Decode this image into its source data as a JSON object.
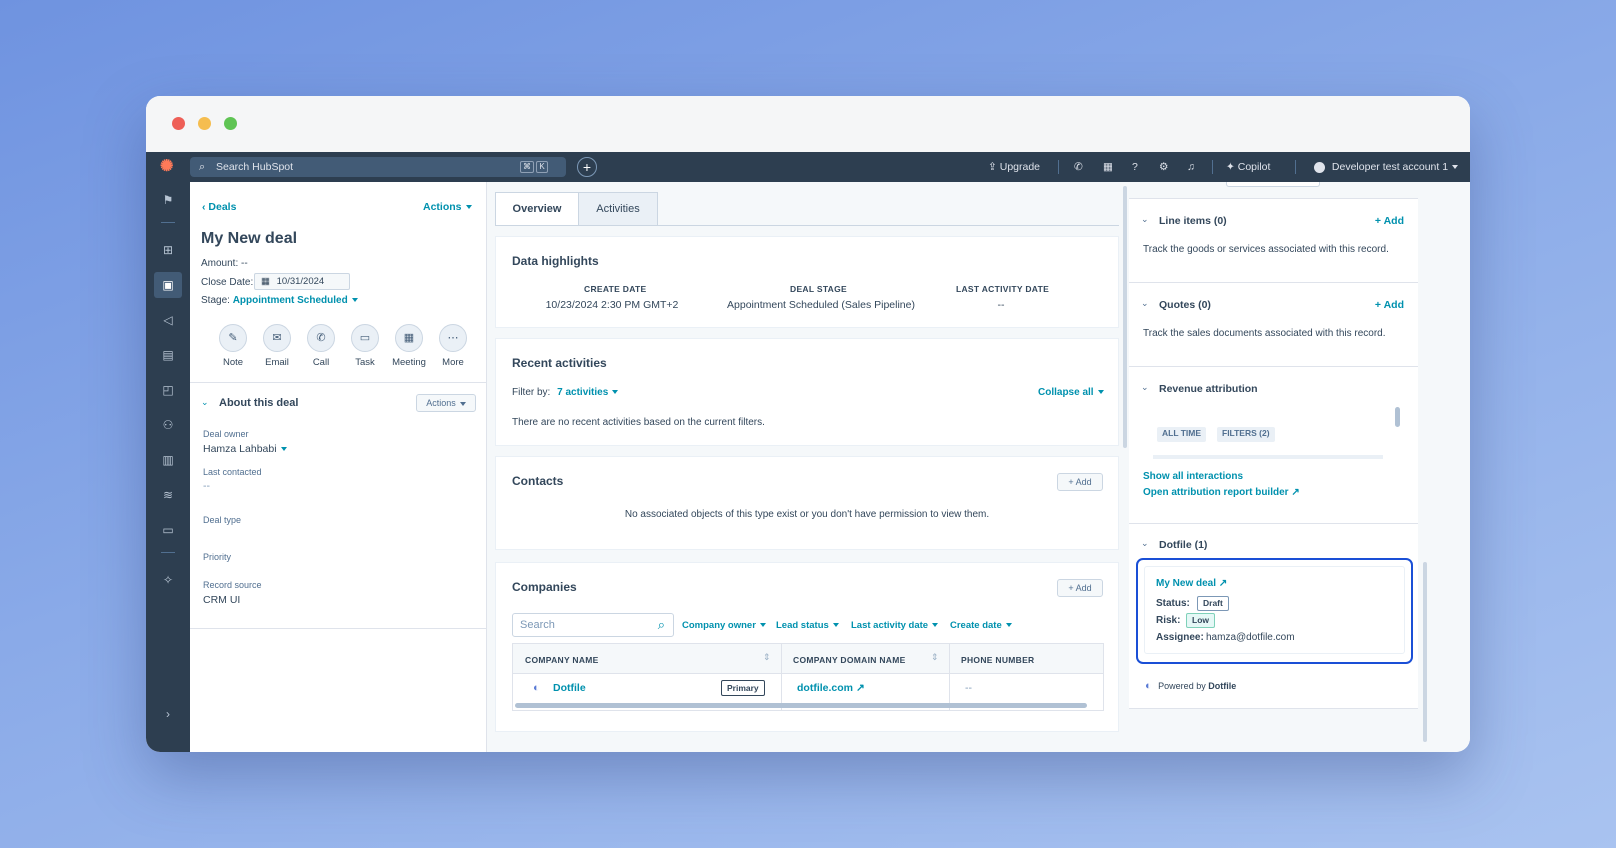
{
  "topnav": {
    "search_placeholder": "Search HubSpot",
    "kbd1": "⌘",
    "kbd2": "K",
    "upgrade": "Upgrade",
    "copilot": "Copilot",
    "account": "Developer test account 1"
  },
  "left": {
    "back": "Deals",
    "actions": "Actions",
    "title": "My New deal",
    "amount_label": "Amount:",
    "amount_value": "--",
    "close_label": "Close Date:",
    "close_value": "10/31/2024",
    "stage_label": "Stage:",
    "stage_value": "Appointment Scheduled",
    "quick_actions": [
      "Note",
      "Email",
      "Call",
      "Task",
      "Meeting",
      "More"
    ],
    "about_title": "About this deal",
    "about_actions": "Actions",
    "fields": [
      {
        "label": "Deal owner",
        "value": "Hamza Lahbabi"
      },
      {
        "label": "Last contacted",
        "value": "--"
      },
      {
        "label": "Deal type",
        "value": ""
      },
      {
        "label": "Priority",
        "value": ""
      },
      {
        "label": "Record source",
        "value": "CRM UI"
      }
    ]
  },
  "center": {
    "tabs": [
      "Overview",
      "Activities"
    ],
    "highlights": {
      "title": "Data highlights",
      "cols": [
        {
          "label": "CREATE DATE",
          "value": "10/23/2024 2:30 PM GMT+2"
        },
        {
          "label": "DEAL STAGE",
          "value": "Appointment Scheduled (Sales Pipeline)"
        },
        {
          "label": "LAST ACTIVITY DATE",
          "value": "--"
        }
      ]
    },
    "recent": {
      "title": "Recent activities",
      "filter_label": "Filter by:",
      "filter_value": "7 activities",
      "collapse": "Collapse all",
      "empty": "There are no recent activities based on the current filters."
    },
    "contacts": {
      "title": "Contacts",
      "add": "+ Add",
      "empty": "No associated objects of this type exist or you don't have permission to view them."
    },
    "companies": {
      "title": "Companies",
      "add": "+ Add",
      "search_placeholder": "Search",
      "filters": [
        "Company owner",
        "Lead status",
        "Last activity date",
        "Create date"
      ],
      "columns": [
        "COMPANY NAME",
        "COMPANY DOMAIN NAME",
        "PHONE NUMBER"
      ],
      "rows": [
        {
          "name": "Dotfile",
          "badge": "Primary",
          "domain": "dotfile.com",
          "phone": "--"
        }
      ]
    }
  },
  "right": {
    "line_items": {
      "title": "Line items (0)",
      "add": "+ Add",
      "desc": "Track the goods or services associated with this record."
    },
    "quotes": {
      "title": "Quotes (0)",
      "add": "+ Add",
      "desc": "Track the sales documents associated with this record."
    },
    "revenue": {
      "title": "Revenue attribution",
      "tags": [
        "ALL TIME",
        "FILTERS (2)"
      ],
      "link1": "Show all interactions",
      "link2": "Open attribution report builder"
    },
    "dotfile": {
      "title": "Dotfile (1)",
      "deal_link": "My New deal",
      "status_label": "Status:",
      "status_value": "Draft",
      "risk_label": "Risk:",
      "risk_value": "Low",
      "assignee_label": "Assignee:",
      "assignee_value": "hamza@dotfile.com",
      "powered": "Powered by",
      "powered_brand": "Dotfile"
    }
  },
  "colors": {
    "accent": "#0091ae",
    "nav": "#2d3e50",
    "highlight_border": "#1a4fd6"
  }
}
